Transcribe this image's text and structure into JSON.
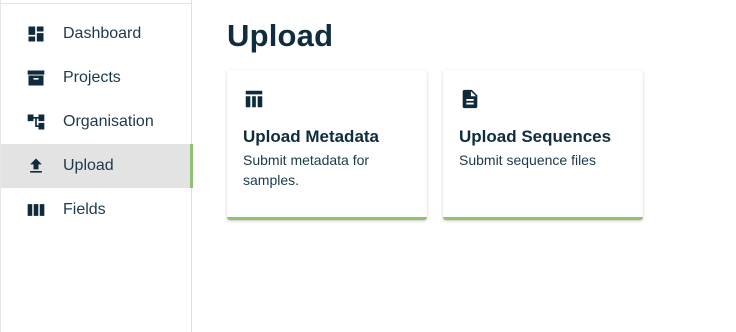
{
  "sidebar": {
    "items": [
      {
        "label": "Dashboard",
        "icon": "dashboard-icon",
        "active": false
      },
      {
        "label": "Projects",
        "icon": "archive-icon",
        "active": false
      },
      {
        "label": "Organisation",
        "icon": "account-tree-icon",
        "active": false
      },
      {
        "label": "Upload",
        "icon": "upload-icon",
        "active": true
      },
      {
        "label": "Fields",
        "icon": "view-column-icon",
        "active": false
      }
    ]
  },
  "main": {
    "title": "Upload",
    "cards": [
      {
        "title": "Upload Metadata",
        "description": "Submit metadata for samples.",
        "icon": "table-icon"
      },
      {
        "title": "Upload Sequences",
        "description": "Submit sequence files",
        "icon": "document-icon"
      }
    ]
  },
  "colors": {
    "accent": "#8fc46c",
    "text": "#0f2d3d",
    "active_bg": "#e3e3e3"
  }
}
